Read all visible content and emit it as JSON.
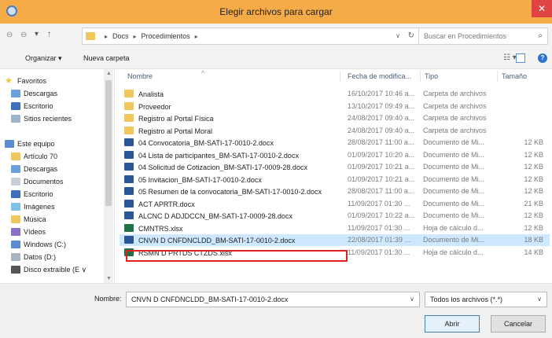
{
  "window": {
    "title": "Elegir archivos para cargar",
    "close_glyph": "✕"
  },
  "address_bar": {
    "back_glyph": "⊖",
    "forward_glyph": "⊖",
    "up_glyph": "↑",
    "path": [
      "Docs",
      "Procedimientos"
    ],
    "search_placeholder": "Buscar en Procedimientos"
  },
  "toolbar": {
    "organize_label": "Organizar ▾",
    "new_folder_label": "Nueva carpeta"
  },
  "nav_pane": {
    "items": [
      {
        "label": "Favoritos",
        "icon": "star-icon",
        "color": "#f2c23a"
      },
      {
        "label": "Descargas",
        "icon": "downloads-folder-icon",
        "color": "#6aa0dc"
      },
      {
        "label": "Escritorio",
        "icon": "desktop-icon",
        "color": "#3f6fbf"
      },
      {
        "label": "Sitios recientes",
        "icon": "recent-places-icon",
        "color": "#9db3c9"
      },
      {
        "label": "Este equipo",
        "icon": "computer-icon",
        "color": "#5b8bd0"
      },
      {
        "label": "Artículo 70",
        "icon": "folder-icon",
        "color": "#f0c75e"
      },
      {
        "label": "Descargas",
        "icon": "downloads-folder-icon",
        "color": "#6aa0dc"
      },
      {
        "label": "Documentos",
        "icon": "documents-folder-icon",
        "color": "#c9cfd8"
      },
      {
        "label": "Escritorio",
        "icon": "desktop-folder-icon",
        "color": "#3f6fbf"
      },
      {
        "label": "Imágenes",
        "icon": "pictures-folder-icon",
        "color": "#7ec0e8"
      },
      {
        "label": "Música",
        "icon": "music-folder-icon",
        "color": "#f0c75e"
      },
      {
        "label": "Vídeos",
        "icon": "videos-folder-icon",
        "color": "#8c6fc7"
      },
      {
        "label": "Windows (C:)",
        "icon": "drive-icon",
        "color": "#5b8bd0"
      },
      {
        "label": "Datos (D:)",
        "icon": "drive-icon",
        "color": "#a9b4c2"
      },
      {
        "label": "Disco extraíble (E ∨",
        "icon": "removable-drive-icon",
        "color": "#555555"
      }
    ]
  },
  "columns": {
    "name": "Nombre",
    "date": "Fecha de modifica...",
    "type": "Tipo",
    "size": "Tamaño"
  },
  "files": [
    {
      "name": "Analista",
      "date": "16/10/2017 10:46 a...",
      "type": "Carpeta de archivos",
      "size": "",
      "kind": "folder"
    },
    {
      "name": "Proveedor",
      "date": "13/10/2017 09:49 a...",
      "type": "Carpeta de archivos",
      "size": "",
      "kind": "folder"
    },
    {
      "name": "Registro al Portal Física",
      "date": "24/08/2017 09:40 a...",
      "type": "Carpeta de archivos",
      "size": "",
      "kind": "folder"
    },
    {
      "name": "Registro al Portal Moral",
      "date": "24/08/2017 09:40 a...",
      "type": "Carpeta de archivos",
      "size": "",
      "kind": "folder"
    },
    {
      "name": "04 Convocatoria_BM-SATI-17-0010-2.docx",
      "date": "28/08/2017 11:00 a...",
      "type": "Documento de Mi...",
      "size": "12 KB",
      "kind": "docx"
    },
    {
      "name": "04 Lista de participantes_BM-SATI-17-0010-2.docx",
      "date": "01/09/2017 10:20 a...",
      "type": "Documento de Mi...",
      "size": "12 KB",
      "kind": "docx"
    },
    {
      "name": "04 Solicitud de Cotizacion_BM-SATI-17-0009-28.docx",
      "date": "01/09/2017 10:21 a...",
      "type": "Documento de Mi...",
      "size": "12 KB",
      "kind": "docx"
    },
    {
      "name": "05 Invitacion_BM-SATI-17-0010-2.docx",
      "date": "01/09/2017 10:21 a...",
      "type": "Documento de Mi...",
      "size": "12 KB",
      "kind": "docx"
    },
    {
      "name": "05 Resumen de la convocatoria_BM-SATI-17-0010-2.docx",
      "date": "28/08/2017 11:00 a...",
      "type": "Documento de Mi...",
      "size": "12 KB",
      "kind": "docx"
    },
    {
      "name": "ACT APRTR.docx",
      "date": "11/09/2017 01:30 ...",
      "type": "Documento de Mi...",
      "size": "21 KB",
      "kind": "docx"
    },
    {
      "name": "ALCNC D ADJDCCN_BM-SATI-17-0009-28.docx",
      "date": "01/09/2017 10:22 a...",
      "type": "Documento de Mi...",
      "size": "12 KB",
      "kind": "docx"
    },
    {
      "name": "CMNTRS.xlsx",
      "date": "11/09/2017 01:30 ...",
      "type": "Hoja de cálculo d...",
      "size": "12 KB",
      "kind": "xlsx"
    },
    {
      "name": "CNVN D CNFDNCLDD_BM-SATI-17-0010-2.docx",
      "date": "22/08/2017 01:39 ...",
      "type": "Documento de Mi...",
      "size": "18 KB",
      "kind": "docx",
      "selected": true
    },
    {
      "name": "RSMN D PRTDS CTZDS.xlsx",
      "date": "11/09/2017 01:30 ...",
      "type": "Hoja de cálculo d...",
      "size": "14 KB",
      "kind": "xlsx"
    }
  ],
  "bottom": {
    "filename_label": "Nombre:",
    "filename_value": "CNVN D CNFDNCLDD_BM-SATI-17-0010-2.docx",
    "filter_value": "Todos los archivos (*.*)",
    "open_label": "Abrir",
    "cancel_label": "Cancelar"
  }
}
